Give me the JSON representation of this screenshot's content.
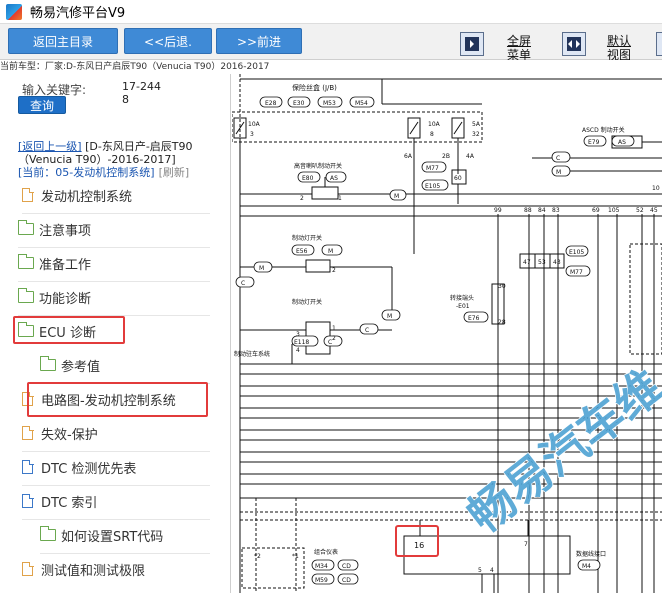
{
  "window": {
    "title": "畅易汽修平台V9"
  },
  "toolbar": {
    "home_label": "返回主目录",
    "back_label": "<<后退.",
    "forward_label": ">>前进",
    "fullscreen_line1": "全屏",
    "fullscreen_line2": "菜单",
    "default_line1": "默认",
    "default_line2": "视图"
  },
  "car_model": "当前车型：厂家:D-东风日产启辰T90（Venucia T90）2016-2017",
  "search": {
    "label": "输入关键字:",
    "value": "17-2448",
    "button": "查询"
  },
  "nav": {
    "back_link": "[返回上一级]",
    "path_title": "[D-东风日产-启辰T90（Venucia T90）-2016-2017]",
    "current": "[当前：05-发动机控制系统]",
    "refresh": "[刷新]"
  },
  "tree": [
    {
      "label": "发动机控制系统"
    },
    {
      "label": "注意事项"
    },
    {
      "label": "准备工作"
    },
    {
      "label": "功能诊断"
    },
    {
      "label": "ECU 诊断"
    },
    {
      "label": "参考值"
    },
    {
      "label": "电路图-发动机控制系统"
    },
    {
      "label": "失效-保护"
    },
    {
      "label": "DTC 检测优先表"
    },
    {
      "label": "DTC 索引"
    },
    {
      "label": "如何设置SRT代码"
    },
    {
      "label": "测试值和测试极限"
    }
  ],
  "diagram": {
    "fuse_box": "保险丝盒 (J/B)",
    "conn_e28": "E28",
    "conn_e30": "E30",
    "conn_m53": "M53",
    "conn_m54": "M54",
    "fuse1_amp": "10A",
    "fuse1_num": "3",
    "fuse2_amp": "10A",
    "fuse2_num": "8",
    "fuse3_amp": "5A",
    "fuse3_num": "32",
    "ascd_switch": "ASCD 制动开关",
    "conn_e79": "E79",
    "conn_as": "AS",
    "wire_6a": "6A",
    "wire_2b": "2B",
    "wire_4a": "4A",
    "brake_sw_high": "高音喇叭制动开关",
    "conn_e80": "E80",
    "conn_as2": "AS",
    "conn_m77": "M77",
    "conn_e105": "E105",
    "node_60": "60",
    "stoplamp_sw1": "制动灯开关",
    "conn_e56": "E56",
    "conn_m": "M",
    "stoplamp_sw2": "制动灯开关",
    "conn_e118": "E118",
    "conn_c": "C",
    "brake_sys": "制动驻车系统",
    "pin_99": "99",
    "pin_88": "88",
    "pin_84": "84",
    "pin_83": "83",
    "pin_69": "69",
    "pin_105": "105",
    "pin_52": "52",
    "pin_45": "45",
    "pin_47": "47",
    "pin_53": "53",
    "pin_43": "43",
    "conn_e105b": "E105",
    "conn_m77b": "M77",
    "pin_10": "10",
    "splice": "转接端头",
    "splice_id": "-E01",
    "conn_e76": "E76",
    "pin_30": "30",
    "pin_28": "28",
    "combo_meter": "组合仪表",
    "conn_m34": "M34",
    "conn_m59": "M59",
    "conn_cd1": "CD",
    "conn_cd2": "CD",
    "pin_2": "*2",
    "pin_1": "*1",
    "pin_16": "16",
    "pin_7": "7",
    "data_link": "数据线接口",
    "conn_m4": "M4",
    "pin_5": "5",
    "pin_4": "4",
    "watermark": "畅易汽车维",
    "pin_1s": "1",
    "pin_2s": "2",
    "pin_3s": "3",
    "pin_4s": "4"
  },
  "colors": {
    "toolbar_button": "#3f8ad6",
    "search_button": "#1e6fc7",
    "link": "#1a55b0",
    "highlight": "#e23b3b",
    "watermark": "#2a8fc9"
  }
}
